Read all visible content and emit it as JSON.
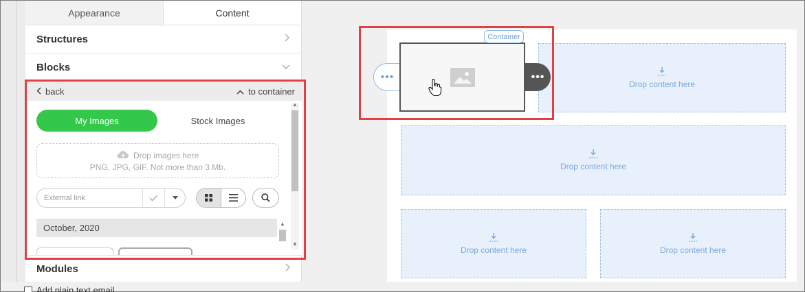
{
  "tabs": [
    {
      "label": "Appearance",
      "active": false
    },
    {
      "label": "Content",
      "active": true
    }
  ],
  "sections": {
    "structures": "Structures",
    "blocks": "Blocks",
    "modules": "Modules"
  },
  "blocks_panel": {
    "back_label": "back",
    "to_container_label": "to container",
    "image_tabs": {
      "my_images": "My Images",
      "stock_images": "Stock Images"
    },
    "dropzone": {
      "line1": "Drop images here",
      "line2": "PNG, JPG, GIF. Not more than 3 Mb."
    },
    "external_link_placeholder": "External link",
    "date_group": "October, 2020"
  },
  "canvas": {
    "container_label": "Container",
    "drop_content_label": "Drop content here",
    "dots_label": "•••"
  },
  "footer": {
    "plain_text_label": "Add plain text email"
  },
  "colors": {
    "accent_green": "#34c84a",
    "highlight_red": "#e14045",
    "drop_blue": "#7aaadb"
  }
}
